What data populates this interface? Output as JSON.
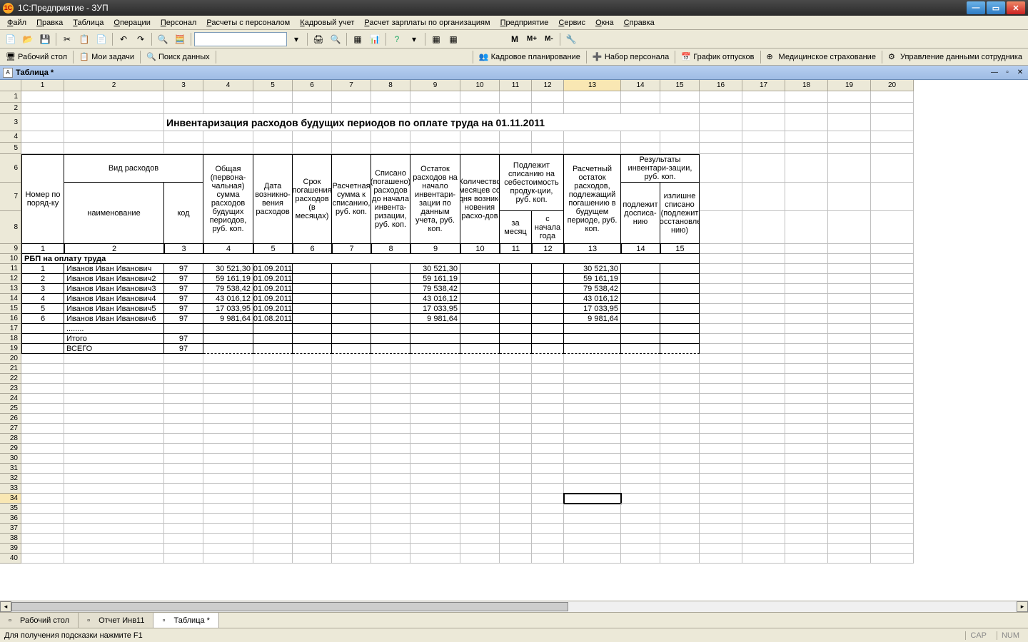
{
  "window": {
    "title": "1С:Предприятие - ЗУП"
  },
  "menu": [
    "Файл",
    "Правка",
    "Таблица",
    "Операции",
    "Персонал",
    "Расчеты с персоналом",
    "Кадровый учет",
    "Расчет зарплаты по организациям",
    "Предприятие",
    "Сервис",
    "Окна",
    "Справка"
  ],
  "toolbar2_items": [
    {
      "icon": "desktop",
      "label": "Рабочий стол"
    },
    {
      "icon": "tasks",
      "label": "Мои задачи"
    },
    {
      "icon": "search",
      "label": "Поиск данных"
    }
  ],
  "toolbar2_right": [
    {
      "icon": "hr",
      "label": "Кадровое планирование"
    },
    {
      "icon": "plus",
      "label": "Набор персонала"
    },
    {
      "icon": "vac",
      "label": "График отпусков"
    },
    {
      "icon": "med",
      "label": "Медицинское страхование"
    },
    {
      "icon": "mgmt",
      "label": "Управление данными сотрудника"
    }
  ],
  "tab_title": "Таблица *",
  "spreadsheet": {
    "title_text": "Инвентаризация расходов будущих периодов по оплате труда на 01.11.2011",
    "col_count": 20,
    "row_count": 40,
    "cursor": {
      "row": 34,
      "col": 13
    },
    "headers": {
      "r6": {
        "vid_rashodov": "Вид расходов",
        "podlezhit_spisaniyu": "Подлежит списанию на себестоимость продук-ции, руб. коп.",
        "rezultaty": "Результаты инвентари-зации, руб. коп."
      },
      "r6_8": {
        "nomer": "Номер по поряд-ку",
        "naimenovanie": "наименование",
        "kod": "код",
        "obshchaya": "Общая (первона-чальная) сумма расходов будущих периодов, руб. коп.",
        "data_vozn": "Дата возникно-вения расходов",
        "srok": "Срок погашения расходов (в месяцах)",
        "raschet_summa": "Расчетная сумма к списанию, руб. коп.",
        "spisano": "Списано (погашено) расходов до начала инвента-ризации, руб. коп.",
        "ostatok_nachalo": "Остаток расходов на начало инвентари-зации по данным учета, руб. коп.",
        "kolichestvo": "Количество месяцев со дня возник-новения расхо-дов",
        "za_mesyac": "за месяц",
        "s_nachala": "с начала года",
        "raschet_ostatok": "Расчетный остаток расходов, подлежащий погашению в будущем периоде, руб. коп.",
        "podlezhit_dospis": "подлежит досписа-нию",
        "izlishne": "излишне списано (подлежит восстановле-нию)"
      },
      "row9": [
        "1",
        "2",
        "3",
        "4",
        "5",
        "6",
        "7",
        "8",
        "9",
        "10",
        "11",
        "12",
        "13",
        "14",
        "15"
      ]
    },
    "section_title": "РБП на оплату труда",
    "rows": [
      {
        "n": "1",
        "name": "Иванов Иван Иванович",
        "code": "97",
        "sum": "30 521,30",
        "date": "01.09.2011",
        "ost_nach": "30 521,30",
        "rasch_ost": "30 521,30"
      },
      {
        "n": "2",
        "name": "Иванов Иван Иванович2",
        "code": "97",
        "sum": "59 161,19",
        "date": "01.09.2011",
        "ost_nach": "59 161,19",
        "rasch_ost": "59 161,19"
      },
      {
        "n": "3",
        "name": "Иванов Иван Иванович3",
        "code": "97",
        "sum": "79 538,42",
        "date": "01.09.2011",
        "ost_nach": "79 538,42",
        "rasch_ost": "79 538,42"
      },
      {
        "n": "4",
        "name": "Иванов Иван Иванович4",
        "code": "97",
        "sum": "43 016,12",
        "date": "01.09.2011",
        "ost_nach": "43 016,12",
        "rasch_ost": "43 016,12"
      },
      {
        "n": "5",
        "name": "Иванов Иван Иванович5",
        "code": "97",
        "sum": "17 033,95",
        "date": "01.09.2011",
        "ost_nach": "17 033,95",
        "rasch_ost": "17 033,95"
      },
      {
        "n": "6",
        "name": "Иванов Иван Иванович6",
        "code": "97",
        "sum": "9 981,64",
        "date": "01.08.2011",
        "ost_nach": "9 981,64",
        "rasch_ost": "9 981,64"
      }
    ],
    "totals": [
      {
        "name": "........",
        "code": ""
      },
      {
        "name": "Итого",
        "code": "97"
      },
      {
        "name": "ВСЕГО",
        "code": "97"
      }
    ]
  },
  "bottom_tabs": [
    {
      "label": "Рабочий стол",
      "active": false
    },
    {
      "label": "Отчет  Инв11",
      "active": false
    },
    {
      "label": "Таблица *",
      "active": true
    }
  ],
  "status": {
    "hint": "Для получения подсказки нажмите F1",
    "cap": "CAP",
    "num": "NUM"
  }
}
